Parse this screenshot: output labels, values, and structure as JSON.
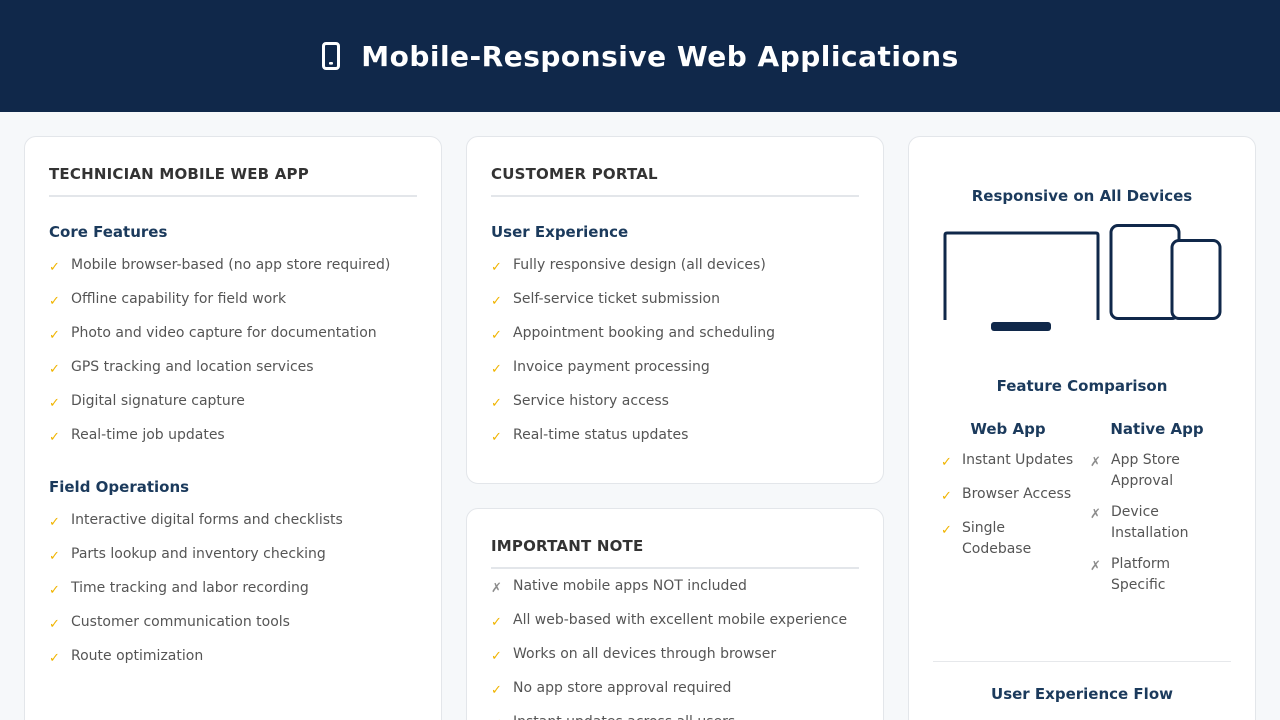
{
  "header": {
    "title": "Mobile-Responsive Web Applications",
    "icon": "mobile-phone-icon"
  },
  "technician": {
    "title": "TECHNICIAN MOBILE WEB APP",
    "sections": [
      {
        "title": "Core Features",
        "items": [
          "Mobile browser-based (no app store required)",
          "Offline capability for field work",
          "Photo and video capture for documentation",
          "GPS tracking and location services",
          "Digital signature capture",
          "Real-time job updates"
        ]
      },
      {
        "title": "Field Operations",
        "items": [
          "Interactive digital forms and checklists",
          "Parts lookup and inventory checking",
          "Time tracking and labor recording",
          "Customer communication tools",
          "Route optimization"
        ]
      }
    ]
  },
  "portal": {
    "title": "CUSTOMER PORTAL",
    "section_title": "User Experience",
    "items": [
      "Fully responsive design (all devices)",
      "Self-service ticket submission",
      "Appointment booking and scheduling",
      "Invoice payment processing",
      "Service history access",
      "Real-time status updates"
    ]
  },
  "note": {
    "title": "IMPORTANT NOTE",
    "items": [
      {
        "mark": "cross",
        "text": "Native mobile apps NOT included"
      },
      {
        "mark": "check",
        "text": "All web-based with excellent mobile experience"
      },
      {
        "mark": "check",
        "text": "Works on all devices through browser"
      },
      {
        "mark": "check",
        "text": "No app store approval required"
      },
      {
        "mark": "check",
        "text": "Instant updates across all users"
      }
    ]
  },
  "devices": {
    "title": "Responsive on All Devices",
    "icons": [
      "laptop-icon",
      "tablet-icon",
      "phone-icon"
    ]
  },
  "comparison": {
    "title": "Feature Comparison",
    "web": {
      "title": "Web App",
      "items": [
        "Instant Updates",
        "Browser Access",
        "Single Codebase"
      ]
    },
    "native": {
      "title": "Native App",
      "items": [
        "App Store Approval",
        "Device Installation",
        "Platform Specific"
      ]
    }
  },
  "flow": {
    "title": "User Experience Flow"
  },
  "colors": {
    "header_bg": "#10284a",
    "accent": "#f0b400",
    "heading": "#1b3a5c",
    "cross": "#8c8c8c"
  },
  "marks": {
    "check": "✓",
    "cross": "✗"
  }
}
